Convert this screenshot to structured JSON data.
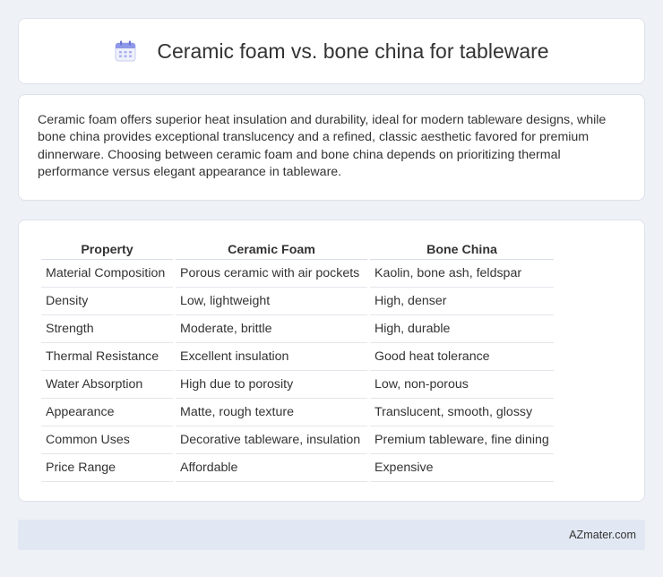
{
  "header": {
    "title": "Ceramic foam vs. bone china for tableware",
    "icon": "calendar-icon"
  },
  "intro": {
    "text": "Ceramic foam offers superior heat insulation and durability, ideal for modern tableware designs, while bone china provides exceptional translucency and a refined, classic aesthetic favored for premium dinnerware. Choosing between ceramic foam and bone china depends on prioritizing thermal performance versus elegant appearance in tableware."
  },
  "table": {
    "headers": [
      "Property",
      "Ceramic Foam",
      "Bone China"
    ],
    "rows": [
      [
        "Material Composition",
        "Porous ceramic with air pockets",
        "Kaolin, bone ash, feldspar"
      ],
      [
        "Density",
        "Low, lightweight",
        "High, denser"
      ],
      [
        "Strength",
        "Moderate, brittle",
        "High, durable"
      ],
      [
        "Thermal Resistance",
        "Excellent insulation",
        "Good heat tolerance"
      ],
      [
        "Water Absorption",
        "High due to porosity",
        "Low, non-porous"
      ],
      [
        "Appearance",
        "Matte, rough texture",
        "Translucent, smooth, glossy"
      ],
      [
        "Common Uses",
        "Decorative tableware, insulation",
        "Premium tableware, fine dining"
      ],
      [
        "Price Range",
        "Affordable",
        "Expensive"
      ]
    ]
  },
  "footer": {
    "text": "AZmater.com"
  },
  "colors": {
    "background": "#eef1f6",
    "card": "#ffffff",
    "footer": "#e2e8f3",
    "icon_accent": "#7b86e0"
  }
}
